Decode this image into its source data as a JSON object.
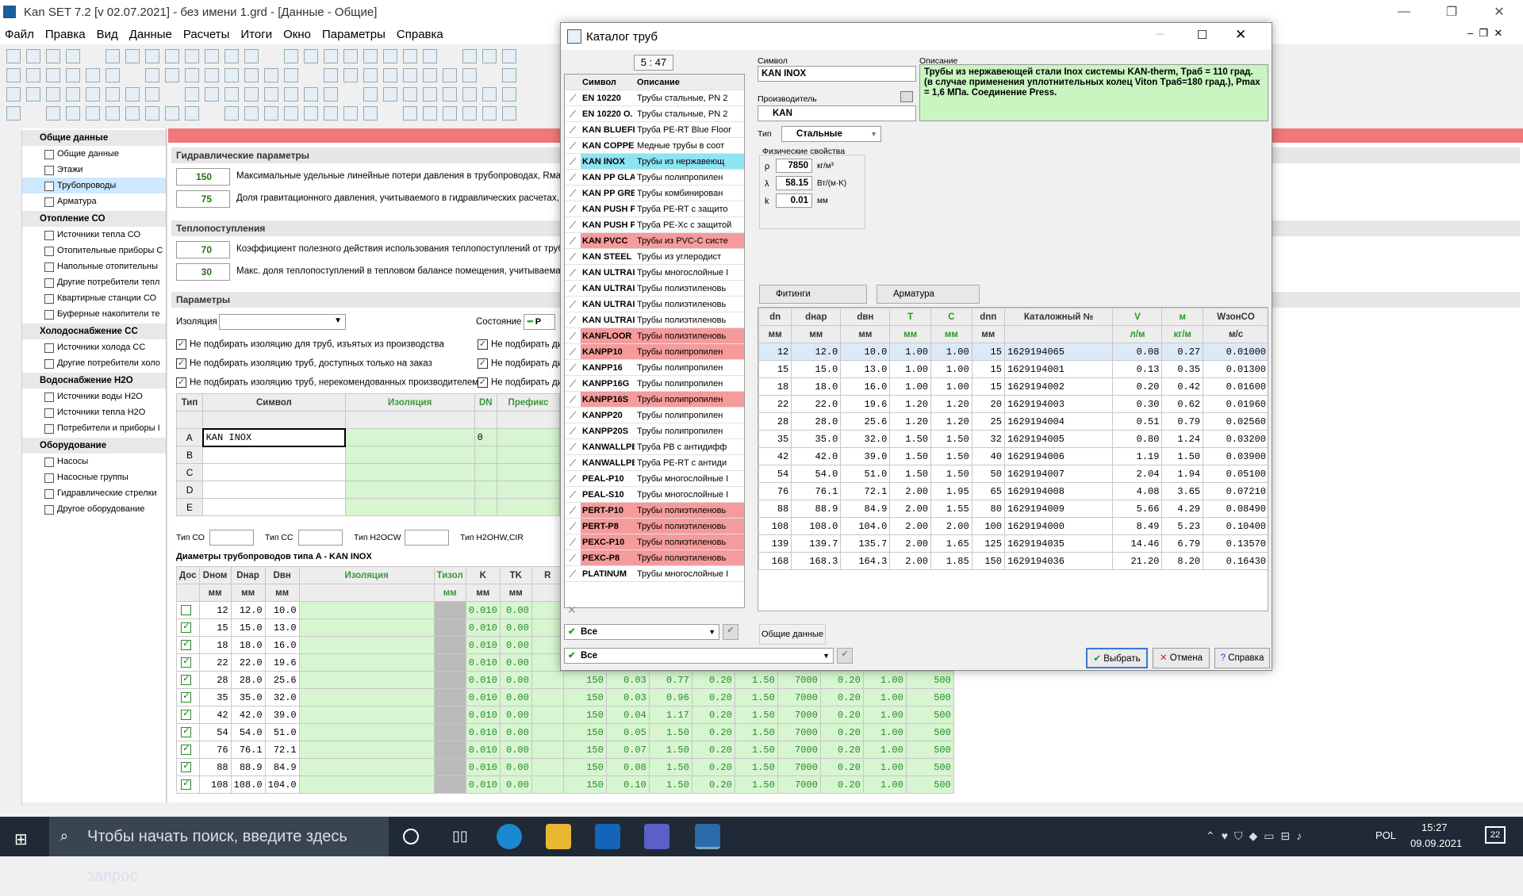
{
  "window": {
    "title": "Kan SET 7.2  [v 02.07.2021] - без имени 1.grd - [Данные - Общие]"
  },
  "menu": [
    "Файл",
    "Правка",
    "Вид",
    "Данные",
    "Расчеты",
    "Итоги",
    "Окно",
    "Параметры",
    "Справка"
  ],
  "tree": {
    "sections": [
      {
        "title": "Общие данные",
        "items": [
          "Общие данные",
          "Этажи",
          "Трубопроводы",
          "Арматура"
        ]
      },
      {
        "title": "Отопление СО",
        "items": [
          "Источники тепла СО",
          "Отопительные приборы С",
          "Напольные отопительны",
          "Другие потребители тепл",
          "Квартирные станции СО",
          "Буферные накопители те"
        ]
      },
      {
        "title": "Холодоснабжение СС",
        "items": [
          "Источники холода СС",
          "Другие потребители холо"
        ]
      },
      {
        "title": "Водоснабжение H2O",
        "items": [
          "Источники воды H2O",
          "Источники тепла H2O",
          "Потребители и приборы I"
        ]
      },
      {
        "title": "Оборудование",
        "items": [
          "Насосы",
          "Насосные группы",
          "Гидравлические стрелки",
          "Другое оборудование"
        ]
      }
    ],
    "selected": "Трубопроводы"
  },
  "hydraulic": {
    "title": "Гидравлические параметры",
    "v1": "150",
    "l1": "Максимальные удельные линейные потери давления в трубопроводах, Rмакс",
    "v2": "75",
    "l2": "Доля гравитационного давления, учитываемого в гидравлических расчетах, Z"
  },
  "heat": {
    "title": "Теплопоступления",
    "v1": "70",
    "l1": "Коэффициент полезного действия использования теплопоступлений от трубопр",
    "v2": "30",
    "l2": "Макс. доля теплопоступлений в тепловом балансе помещения, учитываемая п"
  },
  "params": {
    "title": "Параметры",
    "iso_label": "Изоляция",
    "state_label": "Состояние",
    "state_value": "Р",
    "checks": [
      "Не подбирать изоляцию для труб, изъятых из производства",
      "Не подбирать изоляцию труб, доступных только на заказ",
      "Не подбирать изоляцию труб, нерекомендованных производителем"
    ],
    "checks2": [
      "Не подбирать ди",
      "Не подбирать ди",
      "Не подбирать ди"
    ]
  },
  "typetable": {
    "headers": [
      "Тип",
      "Символ",
      "Изоляция",
      "DN",
      "Префикс"
    ],
    "rows": [
      {
        "t": "A",
        "s": "KAN INOX",
        "n": "0"
      },
      {
        "t": "B",
        "s": "",
        "n": ""
      },
      {
        "t": "C",
        "s": "",
        "n": ""
      },
      {
        "t": "D",
        "s": "",
        "n": ""
      },
      {
        "t": "E",
        "s": "",
        "n": ""
      }
    ]
  },
  "filters": {
    "co": "Тип СО",
    "cc": "Тип СС",
    "h2o": "Тип H2OCW",
    "h2ohw": "Тип H2OHW,CIR"
  },
  "diam": {
    "caption": "Диаметры трубопроводов типа A - KAN INOX",
    "headers": [
      "Дос",
      "Dном",
      "Dнар",
      "Dвн",
      "Изоляция",
      "Тизол",
      "K",
      "TK",
      "R"
    ],
    "units": [
      "",
      "мм",
      "мм",
      "мм",
      "",
      "мм",
      "мм",
      "мм",
      ""
    ],
    "rows": [
      {
        "c": false,
        "d": "12",
        "o": "12.0",
        "i": "10.0",
        "k": "0.010",
        "t": "0.00",
        "x": [
          "",
          "",
          "",
          "",
          "",
          "",
          "",
          ""
        ]
      },
      {
        "c": true,
        "d": "15",
        "o": "15.0",
        "i": "13.0",
        "k": "0.010",
        "t": "0.00",
        "x": [
          "",
          "",
          "",
          "",
          "",
          "",
          "",
          ""
        ]
      },
      {
        "c": true,
        "d": "18",
        "o": "18.0",
        "i": "16.0",
        "k": "0.010",
        "t": "0.00",
        "x": [
          "",
          "",
          "",
          "",
          "",
          "",
          "",
          ""
        ]
      },
      {
        "c": true,
        "d": "22",
        "o": "22.0",
        "i": "19.6",
        "k": "0.010",
        "t": "0.00",
        "x": [
          "",
          "",
          "",
          "",
          "",
          "",
          "",
          ""
        ]
      },
      {
        "c": true,
        "d": "28",
        "o": "28.0",
        "i": "25.6",
        "k": "0.010",
        "t": "0.00",
        "x": [
          "150",
          "0.03",
          "0.77",
          "0.20",
          "1.50",
          "7000",
          "0.20",
          "1.00"
        ],
        "z": "500"
      },
      {
        "c": true,
        "d": "35",
        "o": "35.0",
        "i": "32.0",
        "k": "0.010",
        "t": "0.00",
        "x": [
          "150",
          "0.03",
          "0.96",
          "0.20",
          "1.50",
          "7000",
          "0.20",
          "1.00"
        ],
        "z": "500"
      },
      {
        "c": true,
        "d": "42",
        "o": "42.0",
        "i": "39.0",
        "k": "0.010",
        "t": "0.00",
        "x": [
          "150",
          "0.04",
          "1.17",
          "0.20",
          "1.50",
          "7000",
          "0.20",
          "1.00"
        ],
        "z": "500"
      },
      {
        "c": true,
        "d": "54",
        "o": "54.0",
        "i": "51.0",
        "k": "0.010",
        "t": "0.00",
        "x": [
          "150",
          "0.05",
          "1.50",
          "0.20",
          "1.50",
          "7000",
          "0.20",
          "1.00"
        ],
        "z": "500"
      },
      {
        "c": true,
        "d": "76",
        "o": "76.1",
        "i": "72.1",
        "k": "0.010",
        "t": "0.00",
        "x": [
          "150",
          "0.07",
          "1.50",
          "0.20",
          "1.50",
          "7000",
          "0.20",
          "1.00"
        ],
        "z": "500"
      },
      {
        "c": true,
        "d": "88",
        "o": "88.9",
        "i": "84.9",
        "k": "0.010",
        "t": "0.00",
        "x": [
          "150",
          "0.08",
          "1.50",
          "0.20",
          "1.50",
          "7000",
          "0.20",
          "1.00"
        ],
        "z": "500"
      },
      {
        "c": true,
        "d": "108",
        "o": "108.0",
        "i": "104.0",
        "k": "0.010",
        "t": "0.00",
        "x": [
          "150",
          "0.10",
          "1.50",
          "0.20",
          "1.50",
          "7000",
          "0.20",
          "1.00"
        ],
        "z": "500"
      }
    ]
  },
  "dialog": {
    "title": "Каталог труб",
    "counter": "5 : 47",
    "cat_headers": [
      "Символ",
      "Описание"
    ],
    "catalog": [
      {
        "s": "EN 10220",
        "d": "Трубы стальные, PN 2",
        "c": ""
      },
      {
        "s": "EN 10220 O.",
        "d": "Трубы стальные, PN 2",
        "c": ""
      },
      {
        "s": "KAN BLUEFL",
        "d": "Труба PE-RT Blue Floor",
        "c": ""
      },
      {
        "s": "KAN COPPER",
        "d": "Медные трубы в соот",
        "c": ""
      },
      {
        "s": "KAN INOX",
        "d": "Трубы из нержавеющ",
        "c": "cy"
      },
      {
        "s": "KAN PP GLA",
        "d": "Трубы полипропилен",
        "c": ""
      },
      {
        "s": "KAN PP GRE",
        "d": "Трубы комбинирован",
        "c": ""
      },
      {
        "s": "KAN PUSH P",
        "d": "Труба PE-RT с защито",
        "c": ""
      },
      {
        "s": "KAN PUSH P",
        "d": "Труба PE-Xc с защитой",
        "c": ""
      },
      {
        "s": "KAN PVCC",
        "d": "Трубы из PVC-C систе",
        "c": "pink"
      },
      {
        "s": "KAN STEEL",
        "d": "Трубы из углеродист",
        "c": ""
      },
      {
        "s": "KAN ULTRAI",
        "d": "Трубы многослойные I",
        "c": ""
      },
      {
        "s": "KAN ULTRAI",
        "d": "Трубы полиэтиленовь",
        "c": ""
      },
      {
        "s": "KAN ULTRAI",
        "d": "Трубы полиэтиленовь",
        "c": ""
      },
      {
        "s": "KAN ULTRAI",
        "d": "Трубы полиэтиленовь",
        "c": ""
      },
      {
        "s": "KANFLOOR",
        "d": "Трубы полиэтиленовь",
        "c": "pink"
      },
      {
        "s": "KANPP10",
        "d": "Трубы полипропилен",
        "c": "pink"
      },
      {
        "s": "KANPP16",
        "d": "Трубы полипропилен",
        "c": ""
      },
      {
        "s": "KANPP16G",
        "d": "Трубы полипропилен",
        "c": ""
      },
      {
        "s": "KANPP16S",
        "d": "Трубы полипропилен",
        "c": "pink"
      },
      {
        "s": "KANPP20",
        "d": "Трубы полипропилен",
        "c": ""
      },
      {
        "s": "KANPP20S",
        "d": "Трубы полипропилен",
        "c": ""
      },
      {
        "s": "KANWALLPE",
        "d": "Труба PB с антидифф",
        "c": ""
      },
      {
        "s": "KANWALLPE",
        "d": "Труба PE-RT с антиди",
        "c": ""
      },
      {
        "s": "PEAL-P10",
        "d": "Трубы многослойные I",
        "c": ""
      },
      {
        "s": "PEAL-S10",
        "d": "Трубы многослойные I",
        "c": ""
      },
      {
        "s": "PERT-P10",
        "d": "Трубы полиэтиленовь",
        "c": "pink"
      },
      {
        "s": "PERT-P8",
        "d": "Трубы полиэтиленовь",
        "c": "pink"
      },
      {
        "s": "PEXC-P10",
        "d": "Трубы полиэтиленовь",
        "c": "pink"
      },
      {
        "s": "PEXC-P8",
        "d": "Трубы полиэтиленовь",
        "c": "pink"
      },
      {
        "s": "PLATINUM",
        "d": "Трубы многослойные I",
        "c": ""
      }
    ],
    "symbol_label": "Символ",
    "symbol": "KAN INOX",
    "desc_label": "Описание",
    "description": "Трубы из нержавеющей стали Inox системы KAN-therm, Tраб = 110 град. (в случае применения  уплотнительных колец Viton  Tраб=180 град.), Pmax = 1,6 МПа. Соединение Press.",
    "producer_label": "Производитель",
    "producer": "KAN",
    "type_label": "Тип",
    "type": "Стальные",
    "phys_title": "Физические свойства",
    "phys": [
      {
        "sym": "ρ",
        "val": "7850",
        "unit": "кг/м³"
      },
      {
        "sym": "λ",
        "val": "58.15",
        "unit": "Вт/(м·K)"
      },
      {
        "sym": "k",
        "val": "0.01",
        "unit": "мм"
      }
    ],
    "tab_fittings": "Фитинги",
    "tab_armature": "Арматура",
    "dims_headers": [
      "dn",
      "dнар",
      "dвн",
      "T",
      "C",
      "dnп",
      "Каталожный №",
      "V",
      "м",
      "WзонCO"
    ],
    "dims_units": [
      "мм",
      "мм",
      "мм",
      "мм",
      "мм",
      "мм",
      "",
      "л/м",
      "кг/м",
      "м/с"
    ],
    "dims": [
      [
        "12",
        "12.0",
        "10.0",
        "1.00",
        "1.00",
        "15",
        "1629194065",
        "0.08",
        "0.27",
        "0.01000"
      ],
      [
        "15",
        "15.0",
        "13.0",
        "1.00",
        "1.00",
        "15",
        "1629194001",
        "0.13",
        "0.35",
        "0.01300"
      ],
      [
        "18",
        "18.0",
        "16.0",
        "1.00",
        "1.00",
        "15",
        "1629194002",
        "0.20",
        "0.42",
        "0.01600"
      ],
      [
        "22",
        "22.0",
        "19.6",
        "1.20",
        "1.20",
        "20",
        "1629194003",
        "0.30",
        "0.62",
        "0.01960"
      ],
      [
        "28",
        "28.0",
        "25.6",
        "1.20",
        "1.20",
        "25",
        "1629194004",
        "0.51",
        "0.79",
        "0.02560"
      ],
      [
        "35",
        "35.0",
        "32.0",
        "1.50",
        "1.50",
        "32",
        "1629194005",
        "0.80",
        "1.24",
        "0.03200"
      ],
      [
        "42",
        "42.0",
        "39.0",
        "1.50",
        "1.50",
        "40",
        "1629194006",
        "1.19",
        "1.50",
        "0.03900"
      ],
      [
        "54",
        "54.0",
        "51.0",
        "1.50",
        "1.50",
        "50",
        "1629194007",
        "2.04",
        "1.94",
        "0.05100"
      ],
      [
        "76",
        "76.1",
        "72.1",
        "2.00",
        "1.95",
        "65",
        "1629194008",
        "4.08",
        "3.65",
        "0.07210"
      ],
      [
        "88",
        "88.9",
        "84.9",
        "2.00",
        "1.55",
        "80",
        "1629194009",
        "5.66",
        "4.29",
        "0.08490"
      ],
      [
        "108",
        "108.0",
        "104.0",
        "2.00",
        "2.00",
        "100",
        "1629194000",
        "8.49",
        "5.23",
        "0.10400"
      ],
      [
        "139",
        "139.7",
        "135.7",
        "2.00",
        "1.65",
        "125",
        "1629194035",
        "14.46",
        "6.79",
        "0.13570"
      ],
      [
        "168",
        "168.3",
        "164.3",
        "2.00",
        "1.85",
        "150",
        "1629194036",
        "21.20",
        "8.20",
        "0.16430"
      ]
    ],
    "filter1": "Все",
    "filter2": "Все",
    "general_btn": "Общие данные",
    "ok": "Выбрать",
    "cancel": "Отмена",
    "help": "Справка"
  },
  "taskbar": {
    "search": "Чтобы начать поиск, введите здесь запрос",
    "lang": "POL",
    "time": "15:27",
    "date": "09.09.2021",
    "notif": "22"
  }
}
